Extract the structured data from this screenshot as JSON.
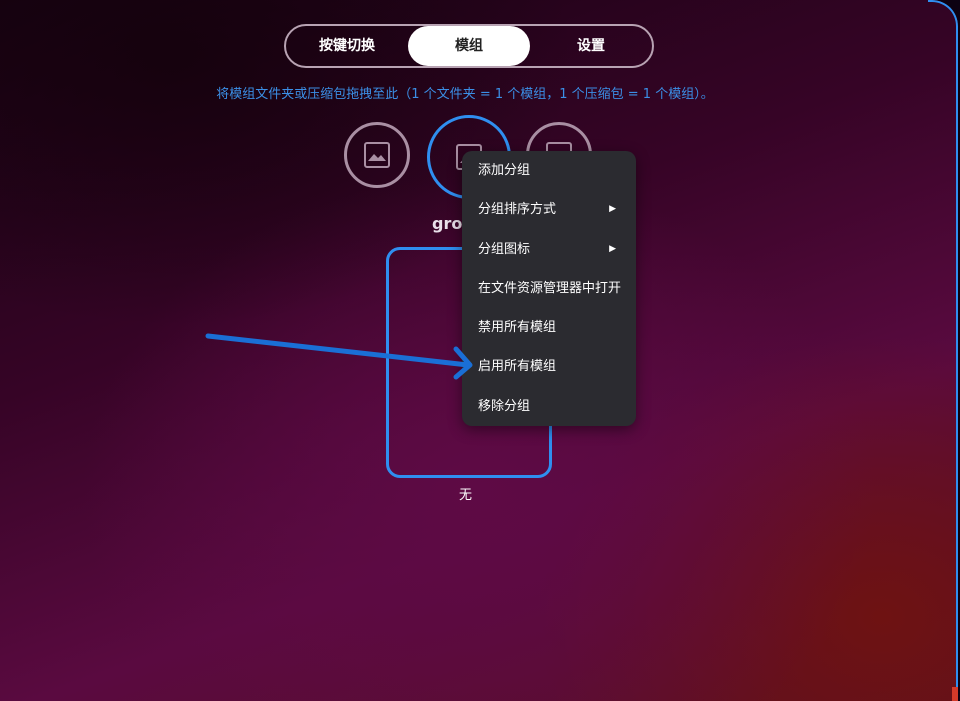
{
  "tabs": [
    {
      "label": "按键切换",
      "active": false
    },
    {
      "label": "模组",
      "active": true
    },
    {
      "label": "设置",
      "active": false
    }
  ],
  "hint_text": "将模组文件夹或压缩包拖拽至此（1 个文件夹 = 1 个模组，1 个压缩包 = 1 个模组）。",
  "groups": {
    "icons": [
      "image-icon",
      "image-icon",
      "image-icon"
    ],
    "selected_index": 1,
    "selected_label": "grou"
  },
  "mod_card": {
    "caption": "无"
  },
  "context_menu": {
    "items": [
      {
        "label": "添加分组",
        "has_submenu": false
      },
      {
        "label": "分组排序方式",
        "has_submenu": true
      },
      {
        "label": "分组图标",
        "has_submenu": true
      },
      {
        "label": "在文件资源管理器中打开",
        "has_submenu": false
      },
      {
        "label": "禁用所有模组",
        "has_submenu": false
      },
      {
        "label": "启用所有模组",
        "has_submenu": false
      },
      {
        "label": "移除分组",
        "has_submenu": false
      }
    ],
    "submenu_arrow": "▶"
  },
  "colors": {
    "accent": "#2f8ff0",
    "hint": "#3b8fe6",
    "menu_bg": "#2b2b30",
    "annotation_arrow": "#1a6fd6"
  }
}
